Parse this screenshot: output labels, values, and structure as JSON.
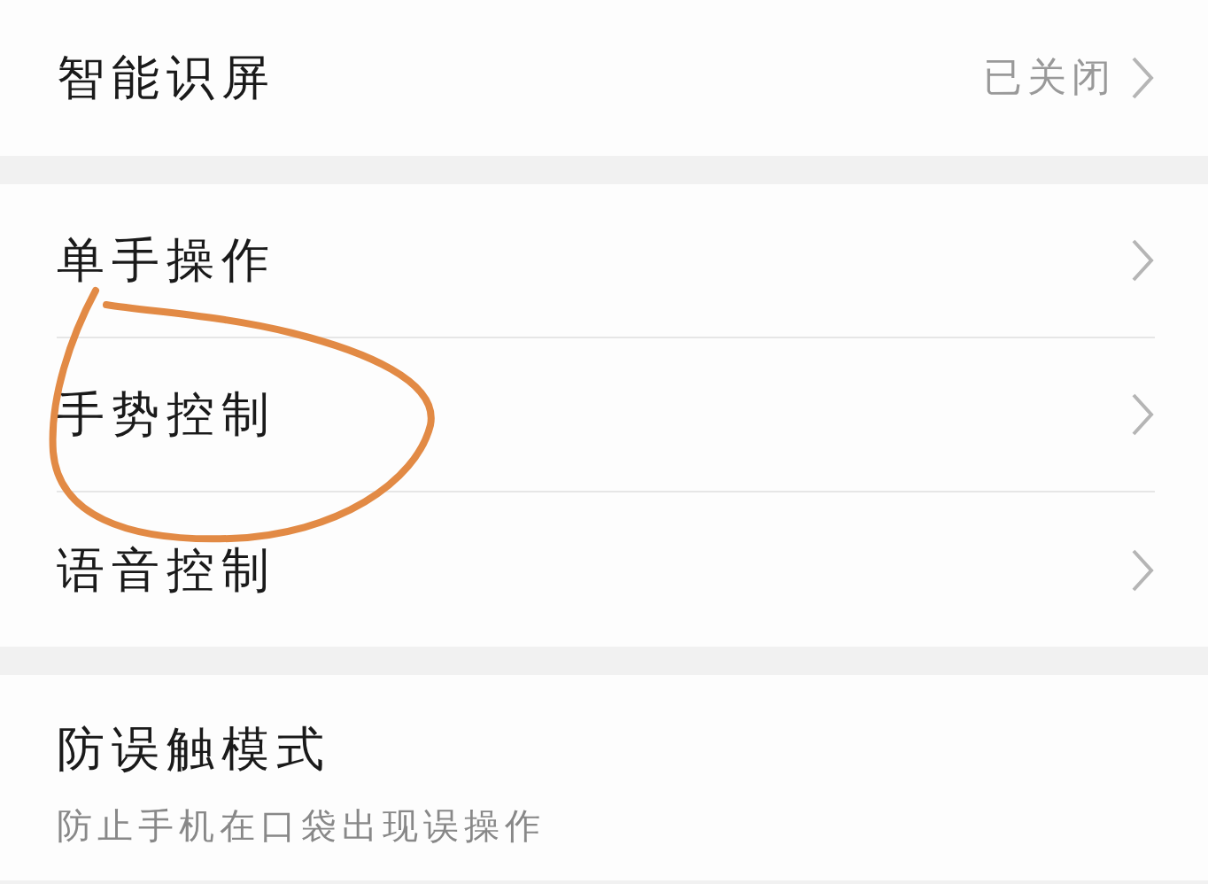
{
  "sections": [
    {
      "items": [
        {
          "title": "智能识屏",
          "value": "已关闭",
          "chevron": true
        }
      ]
    },
    {
      "items": [
        {
          "title": "单手操作",
          "chevron": true
        },
        {
          "title": "手势控制",
          "chevron": true
        },
        {
          "title": "语音控制",
          "chevron": true
        }
      ]
    },
    {
      "items": [
        {
          "title": "防误触模式",
          "subtitle": "防止手机在口袋出现误操作"
        }
      ]
    }
  ],
  "annotation": {
    "kind": "circle"
  }
}
